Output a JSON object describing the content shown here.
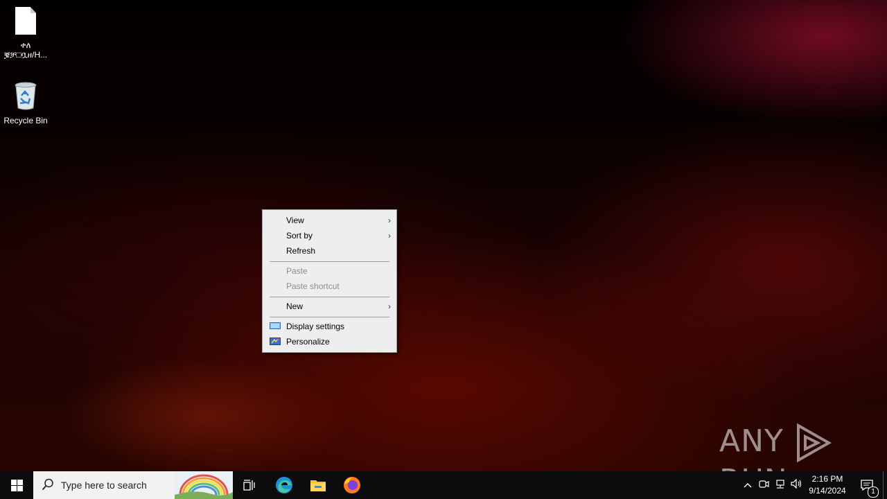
{
  "desktop": {
    "icons": [
      {
        "label_line1": "ቀለ",
        "label_line2": "ቜቻ□ቧዘ/H..."
      },
      {
        "label_line1": "Recycle Bin"
      }
    ]
  },
  "context_menu": {
    "items": [
      {
        "label": "View",
        "submenu": true,
        "enabled": true
      },
      {
        "label": "Sort by",
        "submenu": true,
        "enabled": true
      },
      {
        "label": "Refresh",
        "enabled": true
      },
      {
        "label": "Paste",
        "enabled": false
      },
      {
        "label": "Paste shortcut",
        "enabled": false
      },
      {
        "label": "New",
        "submenu": true,
        "enabled": true
      },
      {
        "label": "Display settings",
        "icon": "display-icon",
        "enabled": true
      },
      {
        "label": "Personalize",
        "icon": "personalize-icon",
        "enabled": true
      }
    ],
    "arrow_glyph": "›"
  },
  "watermark": {
    "left": "ANY",
    "right": "RUN"
  },
  "taskbar": {
    "search_placeholder": "Type here to search",
    "pinned": [
      "task-view-icon",
      "edge-icon",
      "file-explorer-icon",
      "firefox-icon"
    ],
    "tray": {
      "time": "2:16 PM",
      "date": "9/14/2024",
      "notification_count": "1"
    }
  },
  "colors": {
    "taskbar": "#0c0c0e",
    "menu_bg": "#eeeeee",
    "disabled_text": "#8d8d8d"
  }
}
